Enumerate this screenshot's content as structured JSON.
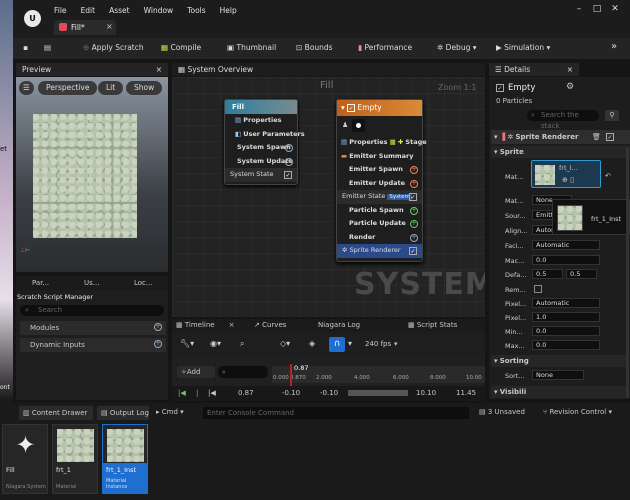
{
  "menu": [
    "File",
    "Edit",
    "Asset",
    "Window",
    "Tools",
    "Help"
  ],
  "tab": {
    "title": "Fill*"
  },
  "toolbar": {
    "apply_scratch": "Apply Scratch",
    "compile": "Compile",
    "thumbnail": "Thumbnail",
    "bounds": "Bounds",
    "performance": "Performance",
    "debug": "Debug",
    "simulation": "Simulation"
  },
  "preview": {
    "title": "Preview",
    "perspective": "Perspective",
    "lit": "Lit",
    "show": "Show"
  },
  "left_tabs": [
    "Par...",
    "Us...",
    "Loc..."
  ],
  "scratch": {
    "title": "Scratch Script Manager",
    "search_placeholder": "Search",
    "modules": "Modules",
    "dynamic_inputs": "Dynamic Inputs"
  },
  "graph": {
    "tab": "System Overview",
    "title": "Fill",
    "zoom": "Zoom 1:1",
    "watermark": "SYSTEM"
  },
  "fill_node": {
    "title": "Fill",
    "rows": [
      "Properties",
      "User Parameters",
      "System Spawn",
      "System Update",
      "System State"
    ]
  },
  "empty_node": {
    "title": "Empty",
    "properties": "Properties",
    "stage": "Stage",
    "rows": [
      "Emitter Summary",
      "Emitter Spawn",
      "Emitter Update",
      "Emitter State",
      "Particle Spawn",
      "Particle Update",
      "Render",
      "Sprite Renderer"
    ],
    "system_tag": "System"
  },
  "timeline": {
    "tabs": [
      "Timeline",
      "Curves",
      "Niagara Log",
      "Script Stats"
    ],
    "fps": "240 fps",
    "add": "Add",
    "marker": "0.87",
    "time": "0.87",
    "range_start": "-0.10",
    "range_start2": "-0.10",
    "range_end": "10.10",
    "range_end2": "11.45",
    "ticks": [
      "0.000",
      "0.870",
      "2.000",
      "4.000",
      "6.000",
      "8.000",
      "10.00"
    ]
  },
  "details": {
    "title": "Details",
    "emitter": "Empty",
    "particles": "0 Particles",
    "search_placeholder": "Search the stack",
    "sprite_renderer": "Sprite Renderer",
    "sprite_section": "Sprite",
    "material_value": "frt_l...",
    "tooltip": "frt_1_Inst",
    "labels": [
      "Mat...",
      "Mat...",
      "Sour...",
      "Align...",
      "Faci...",
      "Mac...",
      "Defa...",
      "Rem...",
      "Pixel...",
      "Pixel...",
      "Min...",
      "Max...",
      "Sorting",
      "Sort...",
      "Visibili"
    ],
    "values": {
      "mat2": "None",
      "sour": "Emitt",
      "align": "Autor",
      "facing": "Automatic",
      "mac": "0.0",
      "def1": "0.5",
      "def2": "0.5",
      "pixel_align": "Automatic",
      "pixel2": "1.0",
      "min": "0.0",
      "max": "0.0",
      "sort": "None"
    }
  },
  "bottom": {
    "content_drawer": "Content Drawer",
    "output_log": "Output Log",
    "cmd": "Cmd",
    "console_placeholder": "Enter Console Command",
    "unsaved": "3 Unsaved",
    "revision": "Revision Control"
  },
  "assets": [
    {
      "name": "Fill",
      "type": "Niagara System"
    },
    {
      "name": "frt_1",
      "type": "Material"
    },
    {
      "name": "frt_1_Inst",
      "type": "Material Instance"
    }
  ],
  "sidebar": {
    "left_text": "et",
    "left_text2": "ont"
  }
}
